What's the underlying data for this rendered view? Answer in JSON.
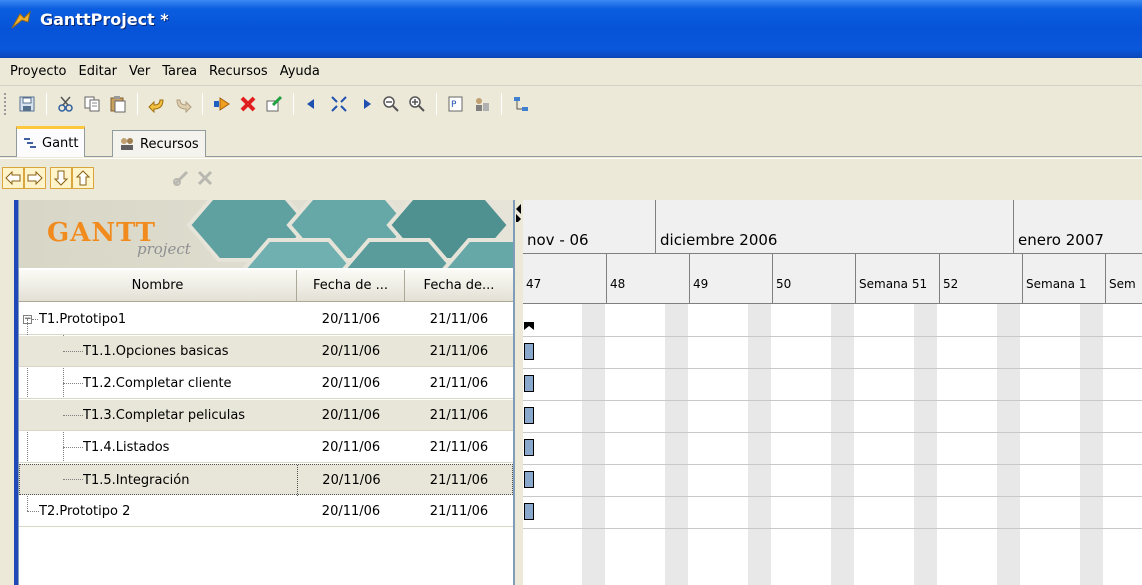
{
  "window": {
    "title": "GanttProject *"
  },
  "menu": [
    "Proyecto",
    "Editar",
    "Ver",
    "Tarea",
    "Recursos",
    "Ayuda"
  ],
  "toolbar": {
    "buttons": [
      "save-icon",
      "cut-icon",
      "copy-icon",
      "paste-icon",
      "undo-icon",
      "redo-icon",
      "new-task-icon",
      "delete-task-icon",
      "edit-task-icon",
      "scroll-left-icon",
      "center-icon",
      "scroll-right-icon",
      "zoom-out-icon",
      "zoom-in-icon",
      "preview-icon",
      "resources-icon",
      "link-icon"
    ]
  },
  "tabs": {
    "gantt": "Gantt",
    "recursos": "Recursos"
  },
  "logo": {
    "main": "GANTT",
    "sub": "project"
  },
  "table": {
    "headers": [
      "Nombre",
      "Fecha de ...",
      "Fecha de..."
    ],
    "rows": [
      {
        "name": "T1.Prototipo1",
        "start": "20/11/06",
        "end": "21/11/06"
      },
      {
        "name": "T1.1.Opciones basicas",
        "start": "20/11/06",
        "end": "21/11/06"
      },
      {
        "name": "T1.2.Completar cliente",
        "start": "20/11/06",
        "end": "21/11/06"
      },
      {
        "name": "T1.3.Completar peliculas",
        "start": "20/11/06",
        "end": "21/11/06"
      },
      {
        "name": "T1.4.Listados",
        "start": "20/11/06",
        "end": "21/11/06"
      },
      {
        "name": "T1.5.Integración",
        "start": "20/11/06",
        "end": "21/11/06"
      },
      {
        "name": "T2.Prototipo 2",
        "start": "20/11/06",
        "end": "21/11/06"
      }
    ]
  },
  "timeline": {
    "months": [
      "nov - 06",
      "diciembre 2006",
      "enero 2007"
    ],
    "weeks": [
      "47",
      "48",
      "49",
      "50",
      "Semana 51",
      "52",
      "Semana 1",
      "Sem"
    ]
  },
  "colors": {
    "titlebar": "#0753d8",
    "task_bar": "#8aa8cc",
    "logo_orange": "#f18b1e"
  }
}
